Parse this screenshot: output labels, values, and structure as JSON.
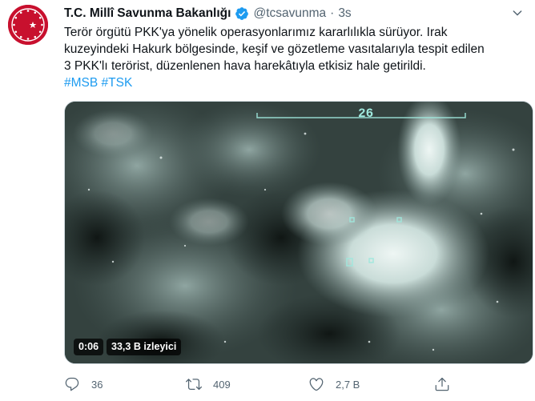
{
  "tweet": {
    "author_name": "T.C. Millî Savunma Bakanlığı",
    "handle": "@tcsavunma",
    "separator": "·",
    "time": "3s",
    "text_lines": [
      "Terör örgütü PKK'ya yönelik operasyonlarımız kararlılıkla sürüyor. Irak",
      "kuzeyindeki Hakurk bölgesinde, keşif ve gözetleme vasıtalarıyla tespit edilen",
      "3 PKK'lı terörist, düzenlenen hava harekâtıyla etkisiz hale getirildi."
    ],
    "hashtags": [
      "#MSB",
      "#TSK"
    ],
    "video": {
      "hud_number": "26",
      "duration": "0:06",
      "views": "33,3 B izleyici"
    },
    "actions": {
      "reply_count": "36",
      "retweet_count": "409",
      "like_count": "2,7 B"
    },
    "colors": {
      "link": "#1d9bf0",
      "verified": "#1d9bf0",
      "avatar_bg": "#c8102e",
      "secondary_text": "#536471"
    },
    "icons": [
      "verified-icon",
      "chevron-down-icon",
      "reply-icon",
      "retweet-icon",
      "like-icon",
      "share-icon"
    ]
  }
}
